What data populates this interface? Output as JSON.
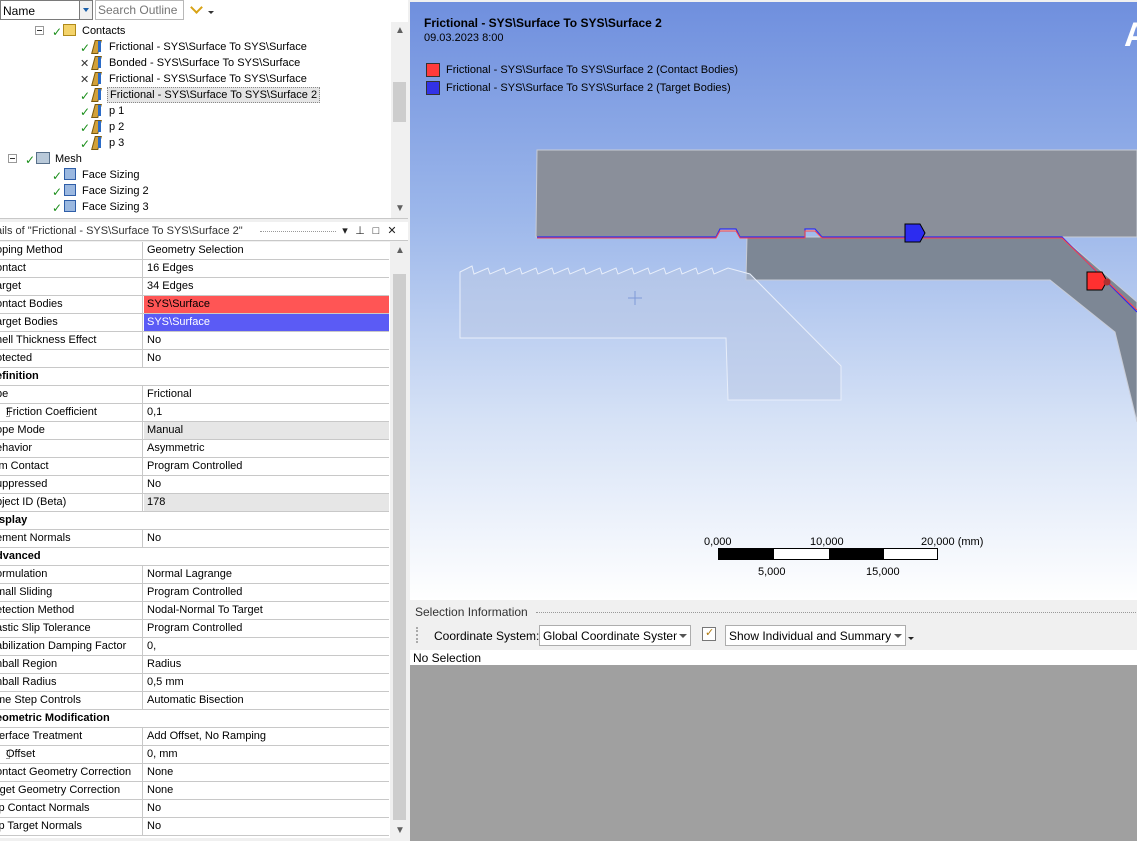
{
  "outline": {
    "name_combo": "Name",
    "search_placeholder": "Search Outline",
    "tree": [
      {
        "label": "Contacts",
        "status": "check",
        "icon": "folder-icon",
        "expanded": true
      },
      {
        "label": "Frictional - SYS\\Surface To SYS\\Surface",
        "status": "check",
        "icon": "contact-icon"
      },
      {
        "label": "Bonded - SYS\\Surface To SYS\\Surface",
        "status": "cross",
        "icon": "contact-icon"
      },
      {
        "label": "Frictional - SYS\\Surface To SYS\\Surface",
        "status": "cross",
        "icon": "contact-icon"
      },
      {
        "label": "Frictional - SYS\\Surface To SYS\\Surface 2",
        "status": "check",
        "icon": "contact-icon",
        "selected": true
      },
      {
        "label": "p 1",
        "status": "check",
        "icon": "contact-icon"
      },
      {
        "label": "p 2",
        "status": "check",
        "icon": "contact-icon"
      },
      {
        "label": "p 3",
        "status": "check",
        "icon": "contact-icon"
      },
      {
        "label": "Mesh",
        "status": "check",
        "icon": "mesh-icon",
        "expanded": true
      },
      {
        "label": "Face Sizing",
        "status": "check",
        "icon": "face-sizing-icon"
      },
      {
        "label": "Face Sizing 2",
        "status": "check",
        "icon": "face-sizing-icon"
      },
      {
        "label": "Face Sizing 3",
        "status": "check",
        "icon": "face-sizing-icon"
      }
    ]
  },
  "details": {
    "title": "ails of \"Frictional - SYS\\Surface To SYS\\Surface 2\"",
    "rows": [
      {
        "k": "oping Method",
        "v": "Geometry Selection"
      },
      {
        "k": "ontact",
        "v": "16 Edges"
      },
      {
        "k": "arget",
        "v": "34 Edges"
      },
      {
        "k": "ontact Bodies",
        "v": "SYS\\Surface",
        "style": "red"
      },
      {
        "k": "arget Bodies",
        "v": "SYS\\Surface",
        "style": "blue"
      },
      {
        "k": "hell Thickness Effect",
        "v": "No"
      },
      {
        "k": "otected",
        "v": "No"
      },
      {
        "k": "efinition",
        "section": true
      },
      {
        "k": "pe",
        "v": "Frictional"
      },
      {
        "k": "Friction Coefficient",
        "v": "0,1",
        "sub": true
      },
      {
        "k": "ope Mode",
        "v": "Manual",
        "style": "grey"
      },
      {
        "k": "ehavior",
        "v": "Asymmetric"
      },
      {
        "k": "im Contact",
        "v": "Program Controlled"
      },
      {
        "k": "uppressed",
        "v": "No"
      },
      {
        "k": "bject ID (Beta)",
        "v": "178",
        "style": "grey"
      },
      {
        "k": "isplay",
        "section": true
      },
      {
        "k": "ement Normals",
        "v": "No"
      },
      {
        "k": "dvanced",
        "section": true
      },
      {
        "k": "ormulation",
        "v": "Normal Lagrange"
      },
      {
        "k": "mall Sliding",
        "v": "Program Controlled"
      },
      {
        "k": "etection Method",
        "v": "Nodal-Normal To Target"
      },
      {
        "k": "astic Slip Tolerance",
        "v": "Program Controlled"
      },
      {
        "k": "abilization Damping Factor",
        "v": "0,"
      },
      {
        "k": "nball Region",
        "v": "Radius"
      },
      {
        "k": "nball Radius",
        "v": "0,5 mm"
      },
      {
        "k": "me Step Controls",
        "v": "Automatic Bisection"
      },
      {
        "k": "eometric Modification",
        "section": true
      },
      {
        "k": "terface Treatment",
        "v": "Add Offset, No Ramping"
      },
      {
        "k": "Offset",
        "v": "0, mm",
        "sub": true
      },
      {
        "k": "ontact Geometry Correction",
        "v": "None"
      },
      {
        "k": "rget Geometry Correction",
        "v": "None"
      },
      {
        "k": "ip Contact Normals",
        "v": "No"
      },
      {
        "k": "ip Target Normals",
        "v": "No"
      }
    ]
  },
  "viewport": {
    "title": "Frictional - SYS\\Surface To SYS\\Surface 2",
    "date": "09.03.2023 8:00",
    "legend": [
      {
        "label": "Frictional - SYS\\Surface To SYS\\Surface 2 (Contact Bodies)",
        "color": "#ff3b3b"
      },
      {
        "label": "Frictional - SYS\\Surface To SYS\\Surface 2 (Target Bodies)",
        "color": "#3232e6"
      }
    ],
    "logo": "A",
    "scale": {
      "top_labels": [
        "0,000",
        "10,000",
        "20,000 (mm)"
      ],
      "bottom_labels": [
        "5,000",
        "15,000"
      ]
    }
  },
  "selection": {
    "title": "Selection Information",
    "coord_label": "Coordinate System:",
    "coord_value": "Global Coordinate System",
    "show_value": "Show Individual and Summary",
    "status": "No Selection"
  }
}
